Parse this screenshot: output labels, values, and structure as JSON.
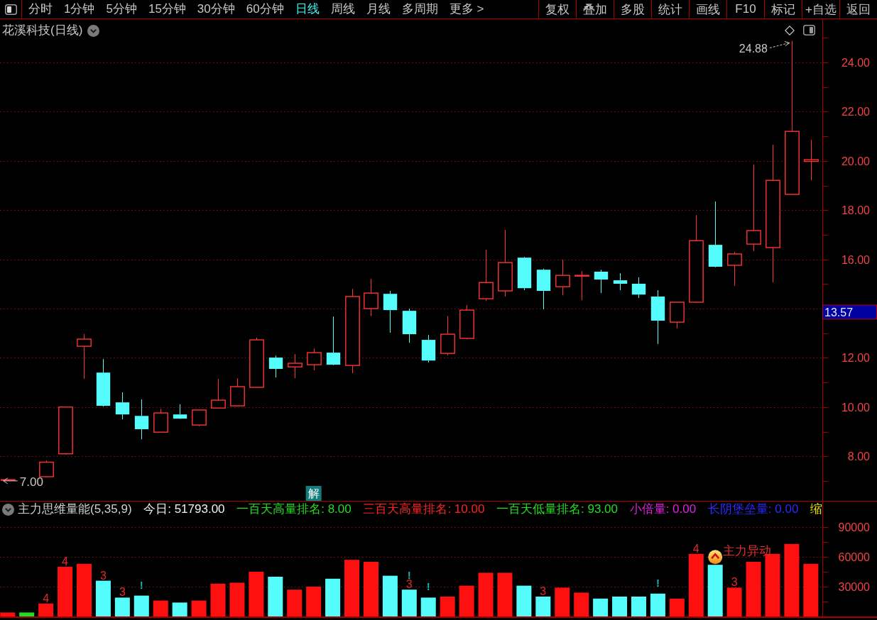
{
  "toolbar": {
    "tabs": [
      {
        "label": "分时",
        "selected": false
      },
      {
        "label": "1分钟",
        "selected": false
      },
      {
        "label": "5分钟",
        "selected": false
      },
      {
        "label": "15分钟",
        "selected": false
      },
      {
        "label": "30分钟",
        "selected": false
      },
      {
        "label": "60分钟",
        "selected": false
      },
      {
        "label": "日线",
        "selected": true
      },
      {
        "label": "周线",
        "selected": false
      },
      {
        "label": "月线",
        "selected": false
      },
      {
        "label": "多周期",
        "selected": false
      }
    ],
    "more": "更多 >",
    "buttons": [
      "复权",
      "叠加",
      "多股",
      "统计",
      "画线",
      "F10",
      "标记",
      "+自选",
      "返回"
    ]
  },
  "price_pane": {
    "title": "花溪科技(日线)",
    "axis_labels": [
      "24.00",
      "22.00",
      "20.00",
      "18.00",
      "16.00",
      "12.00",
      "10.00",
      "8.00"
    ],
    "high_label": "24.88",
    "low_label": "7.00",
    "signal_tag": "解",
    "cursor_price": "13.57"
  },
  "volume_pane": {
    "indicator": [
      {
        "text": "主力思维量能(5,35,9)",
        "color": "#d0d0d0"
      },
      {
        "text": "今日: 51793.00",
        "color": "#f0f0f0"
      },
      {
        "text": "一百天高量排名: 8.00",
        "color": "#22dd22"
      },
      {
        "text": "三百天高量排名: 10.00",
        "color": "#ff2222"
      },
      {
        "text": "一百天低量排名: 93.00",
        "color": "#22dd22"
      },
      {
        "text": "小倍量: 0.00",
        "color": "#e020e0"
      },
      {
        "text": "长阴堡垒量: 0.00",
        "color": "#2a2aff"
      },
      {
        "text": "缩",
        "color": "#e8e800"
      }
    ],
    "chart_data": {
      "type": "bar",
      "ylim": [
        0,
        100000
      ],
      "yticks": [
        30000,
        60000,
        90000
      ],
      "grid": true,
      "series": [
        {
          "values": [
            4000,
            4000,
            13000,
            50000,
            53000,
            36000,
            19000,
            21000,
            16000,
            14000,
            16000,
            33000,
            34000,
            45000,
            40000,
            27000,
            30000,
            38000,
            57000,
            55000,
            41000,
            27000,
            19000,
            20000,
            31000,
            44000,
            44000,
            31000,
            20000,
            29000,
            24000,
            18000,
            20000,
            20000,
            23000,
            18000,
            63000,
            52000,
            29000,
            55000,
            63000,
            73000,
            53000
          ],
          "colors": [
            "#ff1010",
            "#20dd20",
            "#ff1010",
            "#ff1010",
            "#ff1010",
            "#54fcfc",
            "#54fcfc",
            "#54fcfc",
            "#ff1010",
            "#54fcfc",
            "#ff1010",
            "#ff1010",
            "#ff1010",
            "#ff1010",
            "#54fcfc",
            "#ff1010",
            "#ff1010",
            "#54fcfc",
            "#ff1010",
            "#ff1010",
            "#54fcfc",
            "#54fcfc",
            "#54fcfc",
            "#ff1010",
            "#ff1010",
            "#ff1010",
            "#ff1010",
            "#54fcfc",
            "#54fcfc",
            "#ff1010",
            "#ff1010",
            "#54fcfc",
            "#54fcfc",
            "#54fcfc",
            "#54fcfc",
            "#ff1010",
            "#ff1010",
            "#54fcfc",
            "#ff1010",
            "#ff1010",
            "#ff1010",
            "#ff1010",
            "#ff1010"
          ]
        }
      ],
      "annotations": [
        "4",
        "4",
        "3",
        "3",
        "!",
        "3",
        "!",
        "!",
        "3",
        "!",
        "4",
        "主力异动",
        "3"
      ]
    }
  }
}
